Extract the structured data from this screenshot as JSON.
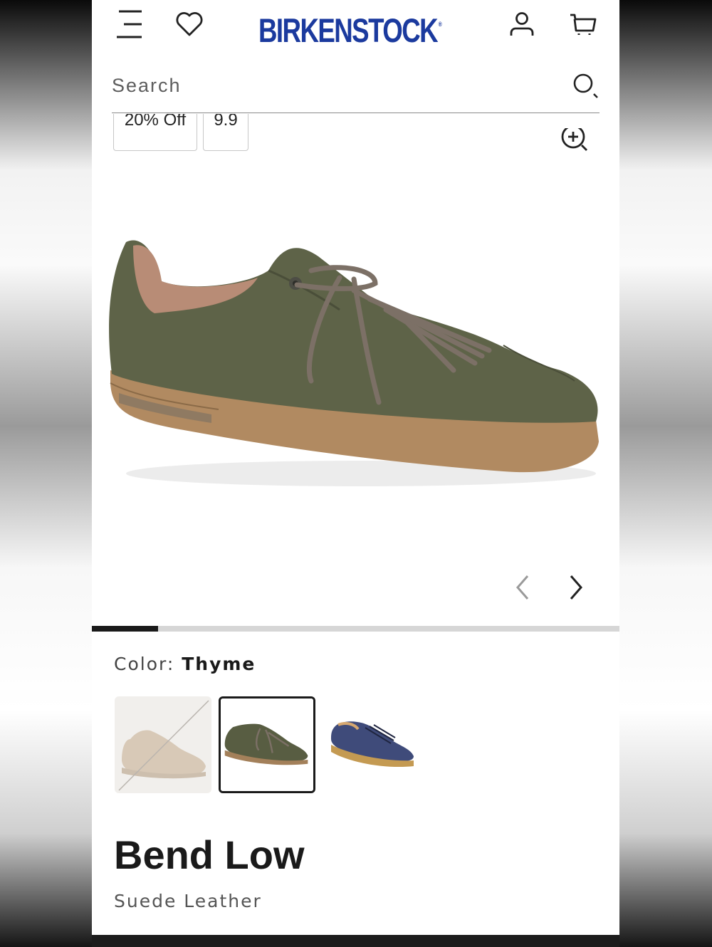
{
  "header": {
    "brand": "BIRKENSTOCK",
    "brand_mark": "®",
    "brand_color": "#1b3a9e",
    "icons": [
      "menu-icon",
      "heart-icon",
      "account-icon",
      "cart-icon"
    ]
  },
  "search": {
    "placeholder": "Search",
    "value": "",
    "icon": "search-icon"
  },
  "gallery": {
    "badges": [
      "20% Off",
      "9.9"
    ],
    "zoom_icon": "zoom-in-icon",
    "image": "shoe-thyme-suede",
    "progress": 0.125
  },
  "color": {
    "label": "Color:",
    "selected": "Thyme",
    "swatches": [
      {
        "name": "Taupe",
        "state": "unavailable"
      },
      {
        "name": "Thyme",
        "state": "selected"
      },
      {
        "name": "Navy",
        "state": "available"
      }
    ]
  },
  "product": {
    "title": "Bend Low",
    "subtitle": "Suede Leather"
  }
}
